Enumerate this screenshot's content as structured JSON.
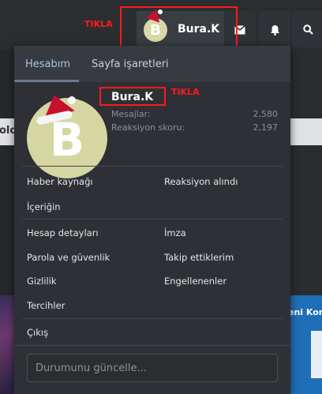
{
  "annotations": {
    "top_label": "TIKLA",
    "inner_label": "TIKLA"
  },
  "navbar": {
    "avatar_letter": "B",
    "username": "Bura.K",
    "icons": [
      "envelope-icon",
      "bell-icon",
      "search-icon"
    ]
  },
  "background": {
    "left_text": "olo",
    "right_text": "eni Kon"
  },
  "panel": {
    "tabs": [
      {
        "label": "Hesabım",
        "active": true
      },
      {
        "label": "Sayfa işaretleri",
        "active": false
      }
    ],
    "user": {
      "avatar_letter": "B",
      "username": "Bura.K",
      "stats": [
        {
          "label": "Mesajlar:",
          "value": "2,580"
        },
        {
          "label": "Reaksiyon skoru:",
          "value": "2,197"
        }
      ]
    },
    "menu": {
      "news_feed": "Haber kaynağı",
      "reactions_received": "Reaksiyon alındı",
      "your_content": "İçeriğin",
      "account_details": "Hesap detayları",
      "signature": "İmza",
      "password_security": "Parola ve güvenlik",
      "following": "Takip ettiklerim",
      "privacy": "Gizlilik",
      "ignored": "Engellenenler",
      "preferences": "Tercihler",
      "logout": "Çıkış"
    },
    "status_placeholder": "Durumunu güncelle..."
  },
  "colors": {
    "annotation": "#ff1a1a",
    "active_tab": "#a9c6e6",
    "hat": "#c8102e"
  }
}
